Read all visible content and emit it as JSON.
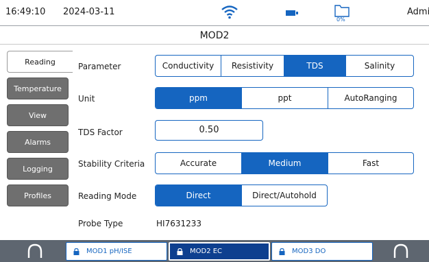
{
  "status": {
    "time": "16:49:10",
    "date": "2024-03-11",
    "storage_percent": "0%",
    "user": "Admin",
    "icons": [
      "wifi-icon",
      "battery-icon",
      "folder-icon"
    ]
  },
  "title": "MOD2",
  "tabs": [
    "Reading",
    "Temperature",
    "View",
    "Alarms",
    "Logging",
    "Profiles"
  ],
  "settings": {
    "parameter": {
      "label": "Parameter",
      "options": [
        "Conductivity",
        "Resistivity",
        "TDS",
        "Salinity"
      ],
      "selected": "TDS"
    },
    "unit": {
      "label": "Unit",
      "options": [
        "ppm",
        "ppt",
        "AutoRanging"
      ],
      "selected": "ppm"
    },
    "tds_factor": {
      "label": "TDS Factor",
      "value": "0.50"
    },
    "stability": {
      "label": "Stability Criteria",
      "options": [
        "Accurate",
        "Medium",
        "Fast"
      ],
      "selected": "Medium"
    },
    "reading_mode": {
      "label": "Reading Mode",
      "options": [
        "Direct",
        "Direct/Autohold"
      ],
      "selected": "Direct"
    },
    "probe_type": {
      "label": "Probe Type",
      "value": "HI7631233"
    }
  },
  "bottom": {
    "modules": [
      {
        "label": "MOD1 pH/ISE",
        "active": false
      },
      {
        "label": "MOD2 EC",
        "active": true
      },
      {
        "label": "MOD3 DO",
        "active": false
      }
    ],
    "icons": [
      "headset-left-icon",
      "headset-right-icon",
      "lock-icon"
    ]
  },
  "colors": {
    "accent": "#1565c0",
    "tab_inactive": "#6f6f6f",
    "bottom_bar": "#5e6670"
  }
}
